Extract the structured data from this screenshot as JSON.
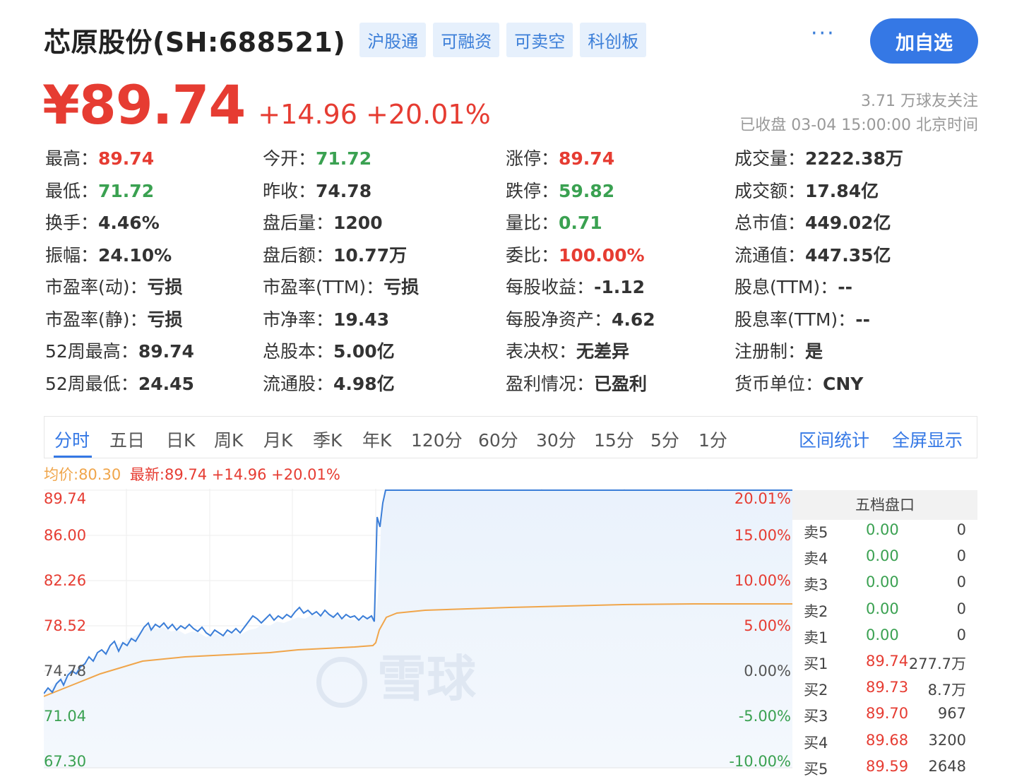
{
  "header": {
    "title": "芯原股份(SH:688521)",
    "tags": [
      "沪股通",
      "可融资",
      "可卖空",
      "科创板"
    ],
    "more": "···",
    "follow_button": "加自选"
  },
  "quote": {
    "price": "¥89.74",
    "change": "+14.96 +20.01%",
    "followers": "3.71 万球友关注",
    "status_time": "已收盘 03-04 15:00:00 北京时间"
  },
  "stats": [
    [
      {
        "label": "最高：",
        "value": "89.74",
        "tone": "red"
      },
      {
        "label": "今开：",
        "value": "71.72",
        "tone": "green"
      },
      {
        "label": "涨停：",
        "value": "89.74",
        "tone": "red"
      },
      {
        "label": "成交量：",
        "value": "2222.38万",
        "tone": ""
      }
    ],
    [
      {
        "label": "最低：",
        "value": "71.72",
        "tone": "green"
      },
      {
        "label": "昨收：",
        "value": "74.78",
        "tone": ""
      },
      {
        "label": "跌停：",
        "value": "59.82",
        "tone": "green"
      },
      {
        "label": "成交额：",
        "value": "17.84亿",
        "tone": ""
      }
    ],
    [
      {
        "label": "换手：",
        "value": "4.46%",
        "tone": ""
      },
      {
        "label": "盘后量：",
        "value": "1200",
        "tone": ""
      },
      {
        "label": "量比：",
        "value": "0.71",
        "tone": "green"
      },
      {
        "label": "总市值：",
        "value": "449.02亿",
        "tone": ""
      }
    ],
    [
      {
        "label": "振幅：",
        "value": "24.10%",
        "tone": ""
      },
      {
        "label": "盘后额：",
        "value": "10.77万",
        "tone": ""
      },
      {
        "label": "委比：",
        "value": "100.00%",
        "tone": "red"
      },
      {
        "label": "流通值：",
        "value": "447.35亿",
        "tone": ""
      }
    ],
    [
      {
        "label": "市盈率(动)：",
        "value": "亏损",
        "tone": ""
      },
      {
        "label": "市盈率(TTM)：",
        "value": "亏损",
        "tone": ""
      },
      {
        "label": "每股收益：",
        "value": "-1.12",
        "tone": ""
      },
      {
        "label": "股息(TTM)：",
        "value": "--",
        "tone": ""
      }
    ],
    [
      {
        "label": "市盈率(静)：",
        "value": "亏损",
        "tone": ""
      },
      {
        "label": "市净率：",
        "value": "19.43",
        "tone": ""
      },
      {
        "label": "每股净资产：",
        "value": "4.62",
        "tone": ""
      },
      {
        "label": "股息率(TTM)：",
        "value": "--",
        "tone": ""
      }
    ],
    [
      {
        "label": "52周最高：",
        "value": "89.74",
        "tone": ""
      },
      {
        "label": "总股本：",
        "value": "5.00亿",
        "tone": ""
      },
      {
        "label": "表决权：",
        "value": "无差异",
        "tone": ""
      },
      {
        "label": "注册制：",
        "value": "是",
        "tone": ""
      }
    ],
    [
      {
        "label": "52周最低：",
        "value": "24.45",
        "tone": ""
      },
      {
        "label": "流通股：",
        "value": "4.98亿",
        "tone": ""
      },
      {
        "label": "盈利情况：",
        "value": "已盈利",
        "tone": ""
      },
      {
        "label": "货币单位：",
        "value": "CNY",
        "tone": ""
      }
    ]
  ],
  "tabs": [
    "分时",
    "五日",
    "日K",
    "周K",
    "月K",
    "季K",
    "年K",
    "120分",
    "60分",
    "30分",
    "15分",
    "5分",
    "1分"
  ],
  "tab_actions": [
    "区间统计",
    "全屏显示"
  ],
  "avg_info": {
    "avg": "均价:80.30",
    "latest": "最新:89.74 +14.96 +20.01%"
  },
  "chart_axes": {
    "left": [
      {
        "label": "89.74",
        "tone": "red"
      },
      {
        "label": "86.00",
        "tone": "red"
      },
      {
        "label": "82.26",
        "tone": "red"
      },
      {
        "label": "78.52",
        "tone": "red"
      },
      {
        "label": "74.78",
        "tone": ""
      },
      {
        "label": "71.04",
        "tone": "green"
      },
      {
        "label": "67.30",
        "tone": "green"
      }
    ],
    "right": [
      {
        "label": "20.01%",
        "tone": "red"
      },
      {
        "label": "15.00%",
        "tone": "red"
      },
      {
        "label": "10.00%",
        "tone": "red"
      },
      {
        "label": "5.00%",
        "tone": "red"
      },
      {
        "label": "0.00%",
        "tone": ""
      },
      {
        "label": "-5.00%",
        "tone": "green"
      },
      {
        "label": "-10.00%",
        "tone": "green"
      }
    ]
  },
  "watermark": "雪球",
  "order_book": {
    "title": "五档盘口",
    "rows": [
      {
        "label": "卖5",
        "price": "0.00",
        "vol": "0",
        "tone": "green"
      },
      {
        "label": "卖4",
        "price": "0.00",
        "vol": "0",
        "tone": "green"
      },
      {
        "label": "卖3",
        "price": "0.00",
        "vol": "0",
        "tone": "green"
      },
      {
        "label": "卖2",
        "price": "0.00",
        "vol": "0",
        "tone": "green"
      },
      {
        "label": "卖1",
        "price": "0.00",
        "vol": "0",
        "tone": "green"
      },
      {
        "label": "买1",
        "price": "89.74",
        "vol": "277.7万",
        "tone": "red"
      },
      {
        "label": "买2",
        "price": "89.73",
        "vol": "8.7万",
        "tone": "red"
      },
      {
        "label": "买3",
        "price": "89.70",
        "vol": "967",
        "tone": "red"
      },
      {
        "label": "买4",
        "price": "89.68",
        "vol": "3200",
        "tone": "red"
      },
      {
        "label": "买5",
        "price": "89.59",
        "vol": "2648",
        "tone": "red"
      }
    ]
  },
  "colors": {
    "up": "#e63c32",
    "down": "#3aa151",
    "accent": "#3578e5",
    "avg_line": "#f0a54a"
  }
}
